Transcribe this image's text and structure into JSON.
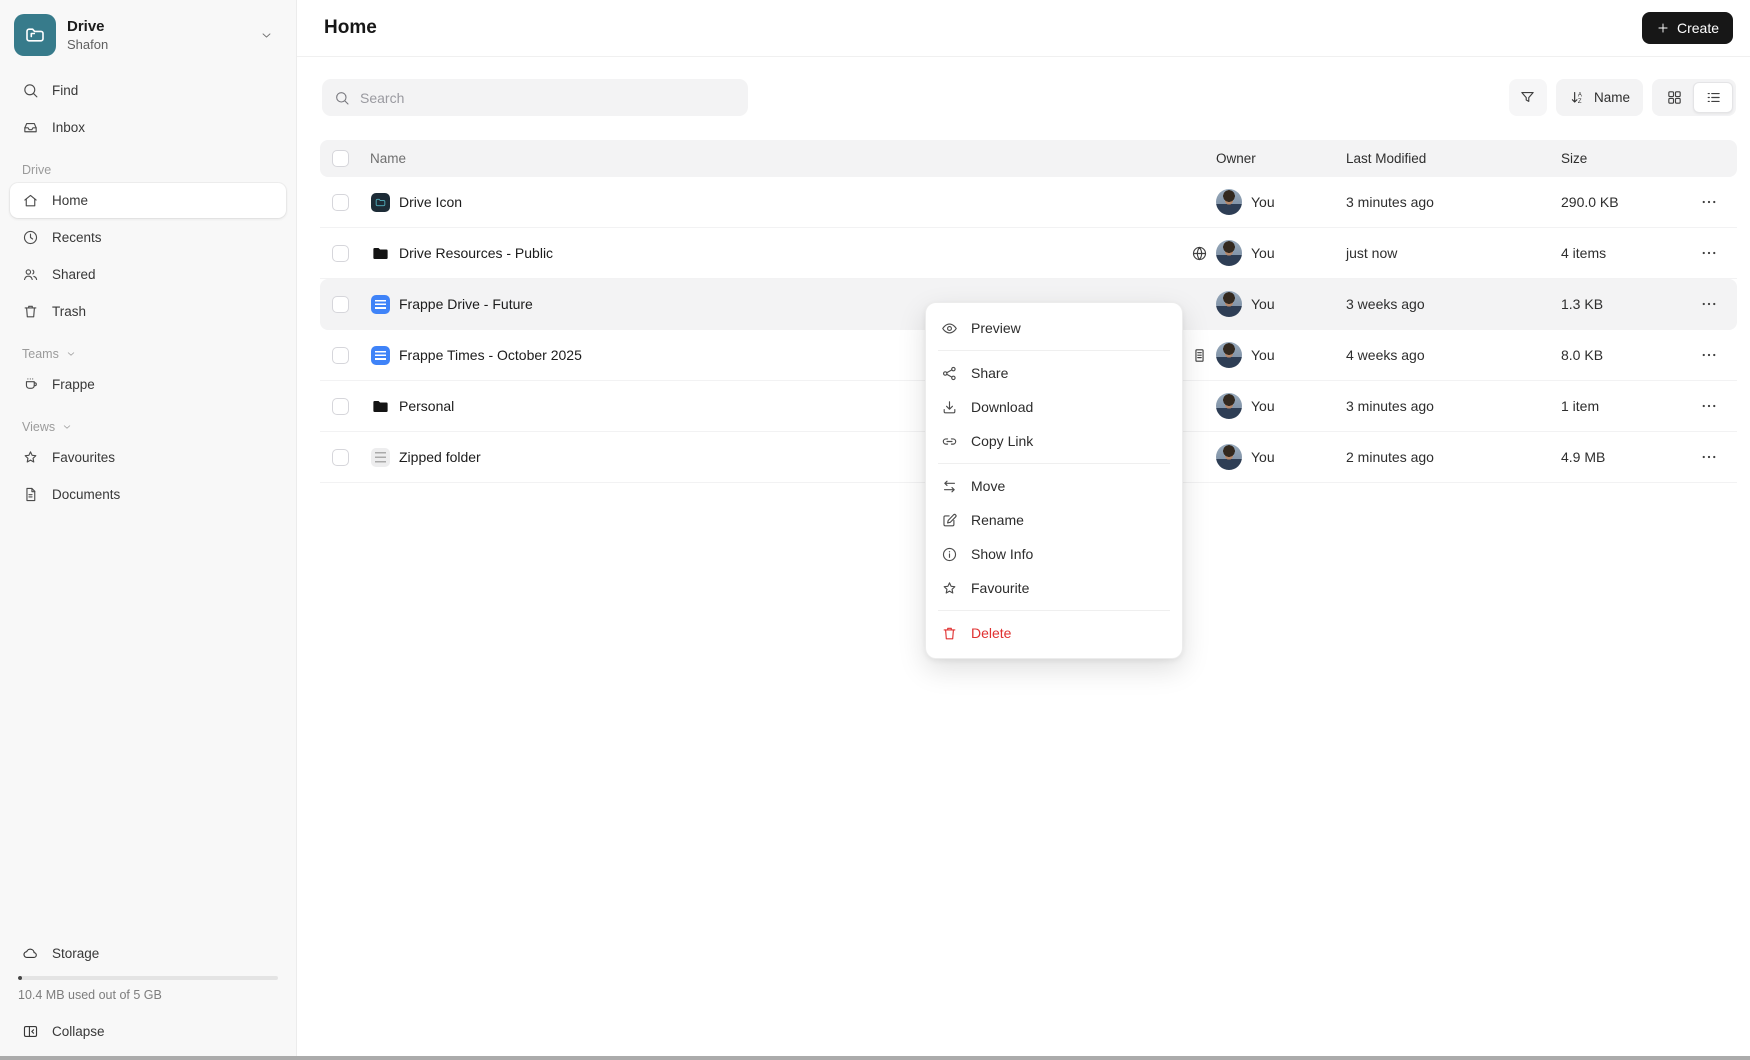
{
  "app": {
    "product": "Drive",
    "workspace": "Shafon"
  },
  "sidebar": {
    "top_items": [
      {
        "label": "Find"
      },
      {
        "label": "Inbox"
      }
    ],
    "drive_section": {
      "label": "Drive",
      "items": [
        {
          "label": "Home",
          "active": true
        },
        {
          "label": "Recents"
        },
        {
          "label": "Shared"
        },
        {
          "label": "Trash"
        }
      ]
    },
    "teams_section": {
      "label": "Teams",
      "items": [
        {
          "label": "Frappe"
        }
      ]
    },
    "views_section": {
      "label": "Views",
      "items": [
        {
          "label": "Favourites"
        },
        {
          "label": "Documents"
        }
      ]
    },
    "storage": {
      "label": "Storage",
      "usage_text": "10.4 MB used out of 5 GB",
      "used_percent": 0.2
    },
    "collapse_label": "Collapse"
  },
  "header": {
    "title": "Home",
    "create_button": "Create"
  },
  "toolbar": {
    "search_placeholder": "Search",
    "sort_button": "Name"
  },
  "table": {
    "headers": {
      "name": "Name",
      "owner": "Owner",
      "last_modified": "Last Modified",
      "size": "Size"
    },
    "rows": [
      {
        "name": "Drive Icon",
        "icon": "drive-image-file",
        "badge": "",
        "owner": "You",
        "modified": "3 minutes ago",
        "size": "290.0 KB",
        "highlighted": false
      },
      {
        "name": "Drive Resources - Public",
        "icon": "folder",
        "badge": "globe",
        "owner": "You",
        "modified": "just now",
        "size": "4 items",
        "highlighted": false
      },
      {
        "name": "Frappe Drive - Future",
        "icon": "document",
        "badge": "",
        "owner": "You",
        "modified": "3 weeks ago",
        "size": "1.3 KB",
        "highlighted": true
      },
      {
        "name": "Frappe Times - October 2025",
        "icon": "document",
        "badge": "building",
        "owner": "You",
        "modified": "4 weeks ago",
        "size": "8.0 KB",
        "highlighted": false
      },
      {
        "name": "Personal",
        "icon": "folder",
        "badge": "",
        "owner": "You",
        "modified": "3 minutes ago",
        "size": "1 item",
        "highlighted": false
      },
      {
        "name": "Zipped folder",
        "icon": "zip",
        "badge": "",
        "owner": "You",
        "modified": "2 minutes ago",
        "size": "4.9 MB",
        "highlighted": false
      }
    ]
  },
  "context_menu": {
    "items": [
      {
        "label": "Preview",
        "icon": "eye-icon"
      },
      {
        "label": "Share",
        "icon": "share-icon"
      },
      {
        "label": "Download",
        "icon": "download-icon"
      },
      {
        "label": "Copy Link",
        "icon": "link-icon"
      },
      {
        "label": "Move",
        "icon": "move-icon"
      },
      {
        "label": "Rename",
        "icon": "rename-icon"
      },
      {
        "label": "Show Info",
        "icon": "info-icon"
      },
      {
        "label": "Favourite",
        "icon": "star-icon"
      },
      {
        "label": "Delete",
        "icon": "trash-icon",
        "danger": true
      }
    ]
  },
  "colors": {
    "accent_teal": "#377B8B",
    "doc_blue": "#3F83F8",
    "danger_red": "#E03131",
    "create_button_bg": "#171717"
  }
}
